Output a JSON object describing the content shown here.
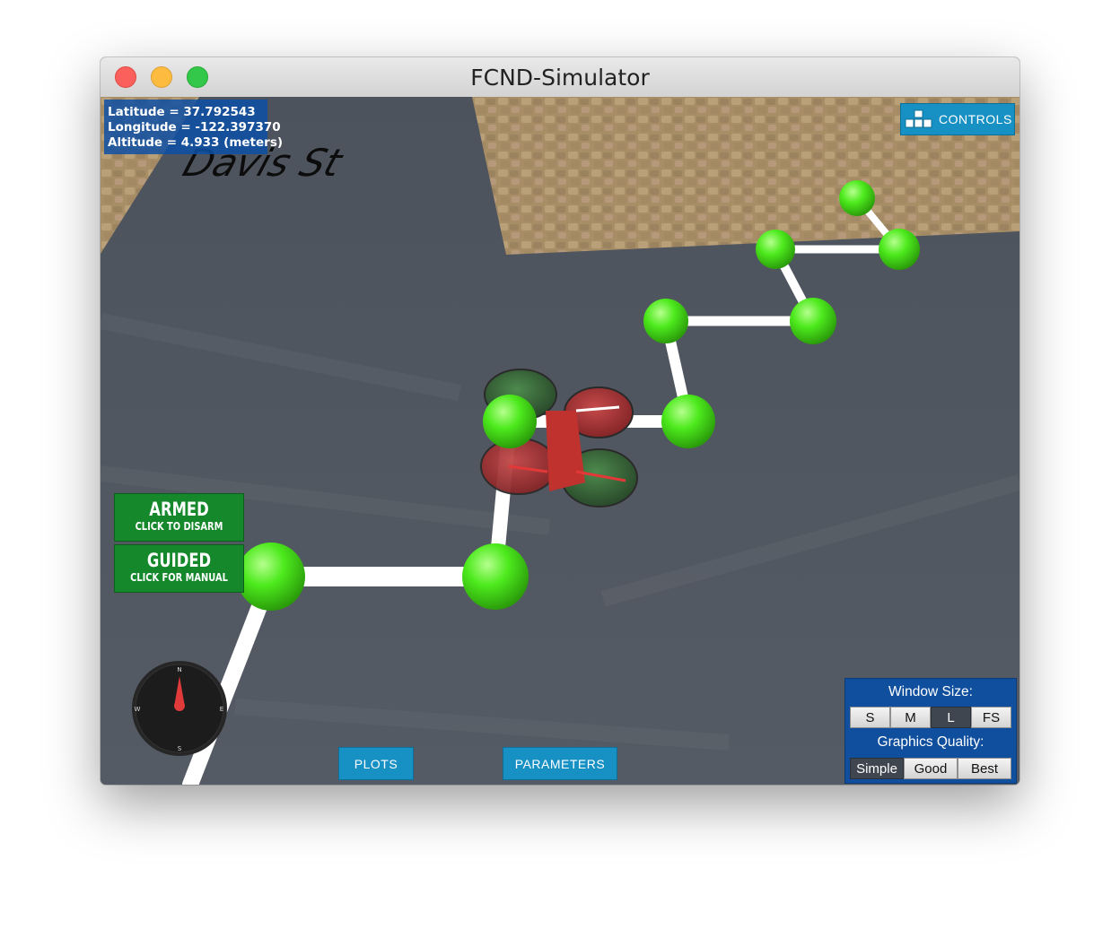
{
  "window": {
    "title": "FCND-Simulator"
  },
  "hud": {
    "latitude": "Latitude = 37.792543",
    "longitude": "Longitude = -122.397370",
    "altitude": "Altitude = 4.933 (meters)"
  },
  "street_label": "Davis St",
  "controls_button": {
    "label": "CONTROLS",
    "icon": "controls-blocks-icon"
  },
  "status_buttons": {
    "armed": {
      "title": "ARMED",
      "subtitle": "CLICK TO DISARM",
      "color": "#15882b"
    },
    "guided": {
      "title": "GUIDED",
      "subtitle": "CLICK FOR MANUAL",
      "color": "#15882b"
    }
  },
  "compass": {
    "n": "N",
    "e": "E",
    "s": "S",
    "w": "W",
    "icon": "compass-needle-icon"
  },
  "bottom_buttons": {
    "plots": "PLOTS",
    "parameters": "PARAMETERS"
  },
  "settings_panel": {
    "window_size_label": "Window Size:",
    "window_size_options": [
      "S",
      "M",
      "L",
      "FS"
    ],
    "window_size_selected": "L",
    "graphics_quality_label": "Graphics Quality:",
    "graphics_quality_options": [
      "Simple",
      "Good",
      "Best"
    ],
    "graphics_quality_selected": "Simple"
  },
  "colors": {
    "accent": "#1790c4",
    "panel": "#0f4f9e",
    "waypoint": "#4dea1d",
    "armed_green": "#15882b"
  }
}
